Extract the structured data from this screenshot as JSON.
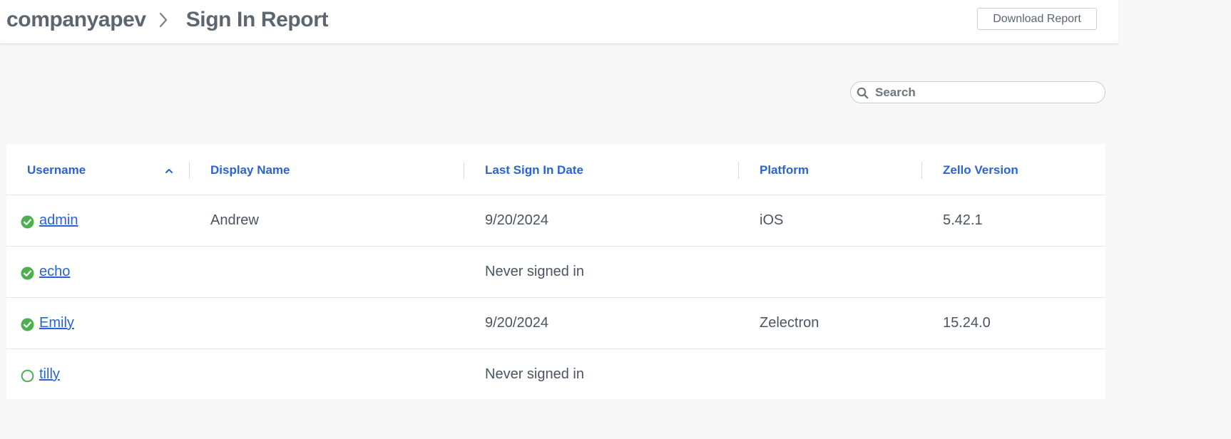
{
  "header": {
    "company": "companyapev",
    "page_title": "Sign In Report",
    "download_label": "Download Report"
  },
  "search": {
    "placeholder": "Search",
    "value": ""
  },
  "table": {
    "columns": [
      "Username",
      "Display Name",
      "Last Sign In Date",
      "Platform",
      "Zello Version"
    ],
    "sort": {
      "column": "Username",
      "direction": "ascending"
    },
    "rows": [
      {
        "username": "admin",
        "display_name": "Andrew",
        "last_sign_in": "9/20/2024",
        "platform": "iOS",
        "version": "5.42.1",
        "status": "active"
      },
      {
        "username": "echo",
        "display_name": "",
        "last_sign_in": "Never signed in",
        "platform": "",
        "version": "",
        "status": "active"
      },
      {
        "username": "Emily",
        "display_name": "",
        "last_sign_in": "9/20/2024",
        "platform": "Zelectron",
        "version": "15.24.0",
        "status": "active"
      },
      {
        "username": "tilly",
        "display_name": "",
        "last_sign_in": "Never signed in",
        "platform": "",
        "version": "",
        "status": "inactive"
      }
    ]
  },
  "colors": {
    "accent": "#2a63d4",
    "status_active": "#4caf50",
    "text": "#4a5561"
  },
  "icons": {
    "breadcrumb_separator": "chevron-right-icon",
    "search": "search-icon",
    "sort": "chevron-up-icon",
    "status_active": "check-circle-icon",
    "status_inactive": "empty-circle-icon"
  }
}
